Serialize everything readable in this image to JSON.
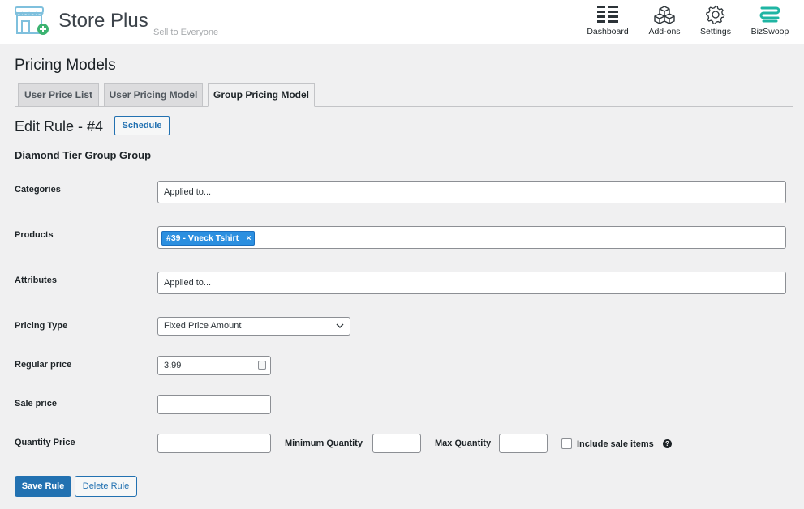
{
  "header": {
    "brand": "Store Plus",
    "tagline": "Sell to Everyone",
    "nav": [
      {
        "label": "Dashboard",
        "icon": "dashboard-icon"
      },
      {
        "label": "Add-ons",
        "icon": "cubes-icon"
      },
      {
        "label": "Settings",
        "icon": "gear-icon"
      },
      {
        "label": "BizSwoop",
        "icon": "bizswoop-logo-icon"
      }
    ]
  },
  "page": {
    "title": "Pricing Models",
    "tabs": [
      {
        "label": "User Price List",
        "active": false
      },
      {
        "label": "User Pricing Model",
        "active": false
      },
      {
        "label": "Group Pricing Model",
        "active": true
      }
    ],
    "edit_title": "Edit Rule - #4",
    "schedule_label": "Schedule",
    "group_name": "Diamond Tier Group Group"
  },
  "form": {
    "categories": {
      "label": "Categories",
      "placeholder": "Applied to..."
    },
    "products": {
      "label": "Products",
      "tags": [
        {
          "text": "#39 - Vneck Tshirt",
          "remove": "×"
        }
      ]
    },
    "attributes": {
      "label": "Attributes",
      "placeholder": "Applied to..."
    },
    "pricing_type": {
      "label": "Pricing Type",
      "value": "Fixed Price Amount"
    },
    "regular_price": {
      "label": "Regular price",
      "value": "3.99"
    },
    "sale_price": {
      "label": "Sale price",
      "value": ""
    },
    "quantity_price": {
      "label": "Quantity Price",
      "value": ""
    },
    "min_quantity": {
      "label": "Minimum Quantity",
      "value": ""
    },
    "max_quantity": {
      "label": "Max Quantity",
      "value": ""
    },
    "include_sale": {
      "label": "Include sale items",
      "checked": false,
      "help": "?"
    }
  },
  "actions": {
    "save": "Save Rule",
    "delete": "Delete Rule"
  },
  "colors": {
    "accent": "#2271b1",
    "tag": "#2b8fe0",
    "logo": "#6fb6d6",
    "bizswoop": "#1fb5a3"
  }
}
